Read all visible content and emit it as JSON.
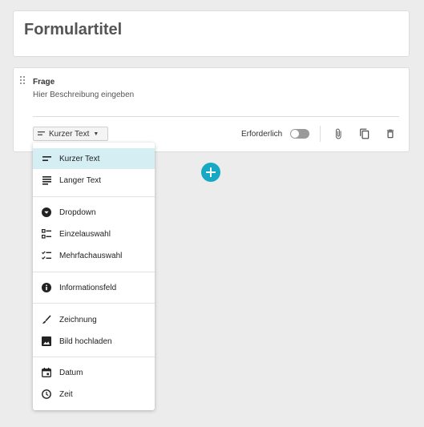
{
  "form": {
    "title": "Formulartitel"
  },
  "question": {
    "title": "Frage",
    "description": "Hier Beschreibung eingeben",
    "type_selected": "Kurzer Text",
    "required_label": "Erforderlich",
    "required": false
  },
  "menu": {
    "items": [
      {
        "label": "Kurzer Text",
        "icon": "short-text-icon"
      },
      {
        "label": "Langer Text",
        "icon": "long-text-icon"
      },
      {
        "label": "Dropdown",
        "icon": "dropdown-icon"
      },
      {
        "label": "Einzelauswahl",
        "icon": "single-choice-icon"
      },
      {
        "label": "Mehrfachauswahl",
        "icon": "multiple-choice-icon"
      },
      {
        "label": "Informationsfeld",
        "icon": "info-icon"
      },
      {
        "label": "Zeichnung",
        "icon": "drawing-icon"
      },
      {
        "label": "Bild hochladen",
        "icon": "image-icon"
      },
      {
        "label": "Datum",
        "icon": "calendar-icon"
      },
      {
        "label": "Zeit",
        "icon": "clock-icon"
      }
    ]
  },
  "colors": {
    "accent": "#17a8c4",
    "selected_bg": "#d4eef4"
  }
}
